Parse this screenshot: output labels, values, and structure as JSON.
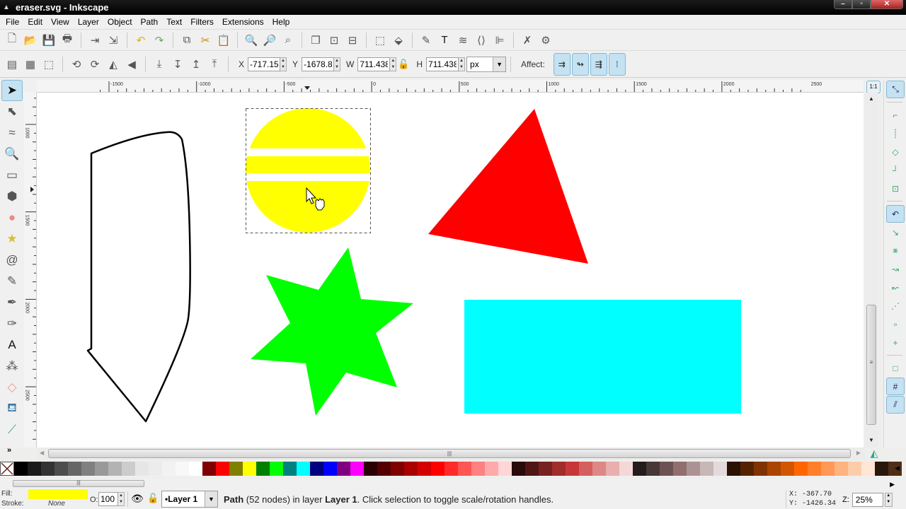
{
  "window": {
    "title": "eraser.svg - Inkscape",
    "buttons": [
      "minimize",
      "maximize",
      "close"
    ]
  },
  "menu": [
    "File",
    "Edit",
    "View",
    "Layer",
    "Object",
    "Path",
    "Text",
    "Filters",
    "Extensions",
    "Help"
  ],
  "commands_bar": [
    {
      "name": "new-document",
      "glyph": "🗋"
    },
    {
      "name": "open",
      "glyph": "📂"
    },
    {
      "name": "save",
      "glyph": "💾"
    },
    {
      "name": "print",
      "glyph": "🖶"
    },
    {
      "sep": true
    },
    {
      "name": "import",
      "glyph": "⇥"
    },
    {
      "name": "export",
      "glyph": "⇲"
    },
    {
      "sep": true
    },
    {
      "name": "undo",
      "glyph": "↶"
    },
    {
      "name": "redo",
      "glyph": "↷"
    },
    {
      "sep": true
    },
    {
      "name": "copy",
      "glyph": "⧉"
    },
    {
      "name": "cut",
      "glyph": "✂"
    },
    {
      "name": "paste",
      "glyph": "📋"
    },
    {
      "sep": true
    },
    {
      "name": "zoom-selection",
      "glyph": "🔍"
    },
    {
      "name": "zoom-drawing",
      "glyph": "🔎"
    },
    {
      "name": "zoom-page",
      "glyph": "⌕"
    },
    {
      "sep": true
    },
    {
      "name": "duplicate",
      "glyph": "❐"
    },
    {
      "name": "clone",
      "glyph": "⊡"
    },
    {
      "name": "unlink-clone",
      "glyph": "⊟"
    },
    {
      "sep": true
    },
    {
      "name": "group",
      "glyph": "⬚"
    },
    {
      "name": "ungroup",
      "glyph": "⬙"
    },
    {
      "sep": true
    },
    {
      "name": "fill-stroke",
      "glyph": "✎"
    },
    {
      "name": "text-font",
      "glyph": "T"
    },
    {
      "name": "layers",
      "glyph": "≋"
    },
    {
      "name": "xml-editor",
      "glyph": "⟨⟩"
    },
    {
      "name": "align-distribute",
      "glyph": "⊫"
    },
    {
      "sep": true
    },
    {
      "name": "preferences",
      "glyph": "✗"
    },
    {
      "name": "document-properties",
      "glyph": "⚙"
    }
  ],
  "tool_controls": {
    "buttons": [
      {
        "name": "select-all",
        "glyph": "▤"
      },
      {
        "name": "select-all-layers",
        "glyph": "▦"
      },
      {
        "name": "deselect",
        "glyph": "⬚"
      },
      {
        "sep": true
      },
      {
        "name": "rotate-ccw",
        "glyph": "⟲"
      },
      {
        "name": "rotate-cw",
        "glyph": "⟳"
      },
      {
        "name": "flip-horizontal",
        "glyph": "◭"
      },
      {
        "name": "flip-vertical",
        "glyph": "◀"
      },
      {
        "sep": true
      },
      {
        "name": "lower-to-bottom",
        "glyph": "⤓"
      },
      {
        "name": "lower",
        "glyph": "↧"
      },
      {
        "name": "raise",
        "glyph": "↥"
      },
      {
        "name": "raise-to-top",
        "glyph": "⤒"
      }
    ],
    "x_label": "X",
    "x_value": "-717.150",
    "y_label": "Y",
    "y_value": "-1678.8",
    "w_label": "W",
    "w_value": "711.438",
    "h_label": "H",
    "h_value": "711.438",
    "unit": "px",
    "affect_label": "Affect:",
    "affect_buttons": [
      "scale-stroke",
      "scale-rounded-corners",
      "transform-gradients",
      "transform-patterns"
    ]
  },
  "rulers": {
    "horizontal_labels": [
      "-1500",
      "-1000",
      "-500",
      "0",
      "500",
      "1000",
      "1500",
      "2000",
      "2500"
    ],
    "vertical_labels": [
      "1000",
      "1500",
      "2000",
      "2500"
    ]
  },
  "toolbox": [
    {
      "name": "selector-tool",
      "glyph": "➤",
      "active": true
    },
    {
      "name": "node-tool",
      "glyph": "⬉"
    },
    {
      "name": "tweak-tool",
      "glyph": "≈"
    },
    {
      "name": "zoom-tool",
      "glyph": "🔍"
    },
    {
      "name": "rectangle-tool",
      "glyph": "▭"
    },
    {
      "name": "3d-box-tool",
      "glyph": "⬢"
    },
    {
      "name": "ellipse-tool",
      "glyph": "●"
    },
    {
      "name": "star-tool",
      "glyph": "★"
    },
    {
      "name": "spiral-tool",
      "glyph": "@"
    },
    {
      "name": "pencil-tool",
      "glyph": "✎"
    },
    {
      "name": "pen-tool",
      "glyph": "✒"
    },
    {
      "name": "calligraphy-tool",
      "glyph": "✑"
    },
    {
      "name": "text-tool",
      "glyph": "A"
    },
    {
      "name": "spray-tool",
      "glyph": "⁂"
    },
    {
      "name": "eraser-tool",
      "glyph": "◇"
    },
    {
      "name": "paint-bucket-tool",
      "glyph": "⛾"
    },
    {
      "name": "connector-tool",
      "glyph": "⟋"
    }
  ],
  "toolbox_overflow": "»",
  "snap_bar": [
    {
      "name": "snap-toggle",
      "glyph": "⤡",
      "active": true
    },
    {
      "sep": true
    },
    {
      "name": "snap-bbox",
      "glyph": "⌐"
    },
    {
      "name": "snap-bbox-edges",
      "glyph": "┊"
    },
    {
      "name": "snap-bbox-corners",
      "glyph": "◇"
    },
    {
      "name": "snap-bbox-midpoints",
      "glyph": "┘"
    },
    {
      "name": "snap-bbox-centers",
      "glyph": "⊡"
    },
    {
      "sep": true
    },
    {
      "name": "snap-nodes",
      "glyph": "↶",
      "active": true
    },
    {
      "name": "snap-paths",
      "glyph": "↘"
    },
    {
      "name": "snap-path-intersections",
      "glyph": "⨳"
    },
    {
      "name": "snap-cusp-nodes",
      "glyph": "↝"
    },
    {
      "name": "snap-smooth-nodes",
      "glyph": "↜"
    },
    {
      "name": "snap-line-midpoints",
      "glyph": "⋰"
    },
    {
      "name": "snap-object-centers",
      "glyph": "∘"
    },
    {
      "name": "snap-rotation-centers",
      "glyph": "+"
    },
    {
      "sep": true
    },
    {
      "name": "snap-page-border",
      "glyph": "□"
    },
    {
      "name": "snap-grid",
      "glyph": "#",
      "active": true
    },
    {
      "name": "snap-guides",
      "glyph": "⫽",
      "active": true
    }
  ],
  "zoom_1to1_label": "1:1",
  "canvas_objects": {
    "selected_object": "yellow circle with two white horizontal stripes (eraser cut)",
    "colors": {
      "yellow": "#ffff00",
      "red": "#ff0000",
      "green": "#00ff00",
      "cyan": "#00ffff",
      "outline": "#000000",
      "background": "#ffffff"
    }
  },
  "palette": [
    "#000000",
    "#1a1a1a",
    "#333333",
    "#4d4d4d",
    "#666666",
    "#808080",
    "#999999",
    "#b3b3b3",
    "#cccccc",
    "#e6e6e6",
    "#ececec",
    "#f2f2f2",
    "#f8f8f8",
    "#ffffff",
    "#800000",
    "#ff0000",
    "#808000",
    "#ffff00",
    "#008000",
    "#00ff00",
    "#008080",
    "#00ffff",
    "#000080",
    "#0000ff",
    "#800080",
    "#ff00ff",
    "#2b0000",
    "#550000",
    "#800000",
    "#aa0000",
    "#d40000",
    "#ff0000",
    "#ff2a2a",
    "#ff5555",
    "#ff8080",
    "#ffaaaa",
    "#ffd5d5",
    "#280b0b",
    "#501616",
    "#782121",
    "#a02c2c",
    "#c83737",
    "#d35f5f",
    "#de8787",
    "#e9afaf",
    "#f4d7d7",
    "#241c1c",
    "#483737",
    "#6c5353",
    "#916f6f",
    "#ac9393",
    "#c8b7b7",
    "#e3dbdb",
    "#2b1100",
    "#552200",
    "#803300",
    "#aa4400",
    "#d45500",
    "#ff6600",
    "#ff7f2a",
    "#ff9955",
    "#ffb380",
    "#ffccaa",
    "#ffe6d5",
    "#28170b",
    "#502d16"
  ],
  "status": {
    "fill_label": "Fill:",
    "fill_color": "#ffff00",
    "stroke_label": "Stroke:",
    "stroke_value": "None",
    "opacity_label": "O:",
    "opacity_value": "100",
    "layer": "•Layer 1",
    "message_bold": "Path",
    "message_rest1": " (52 nodes) in layer ",
    "message_layer": "Layer 1",
    "message_rest2": ". Click selection to toggle scale/rotation handles.",
    "cursor_x": "X:  -367.70",
    "cursor_y": "Y: -1426.34",
    "zoom_label": "Z:",
    "zoom_value": "25%"
  }
}
